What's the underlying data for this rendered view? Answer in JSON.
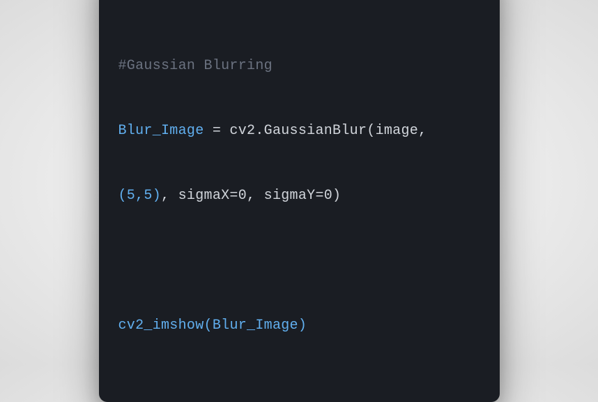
{
  "code": {
    "line1_comment": "#Gaussian Blurring",
    "line2": {
      "var": "Blur_Image",
      "assign": " = cv2.GaussianBlur(image, "
    },
    "line3": {
      "tuple": "(5,5)",
      "rest": ", sigmaX=0, sigmaY=0)"
    },
    "line5": {
      "func": "cv2_imshow",
      "open": "(",
      "arg": "Blur_Image",
      "close": ")"
    }
  }
}
